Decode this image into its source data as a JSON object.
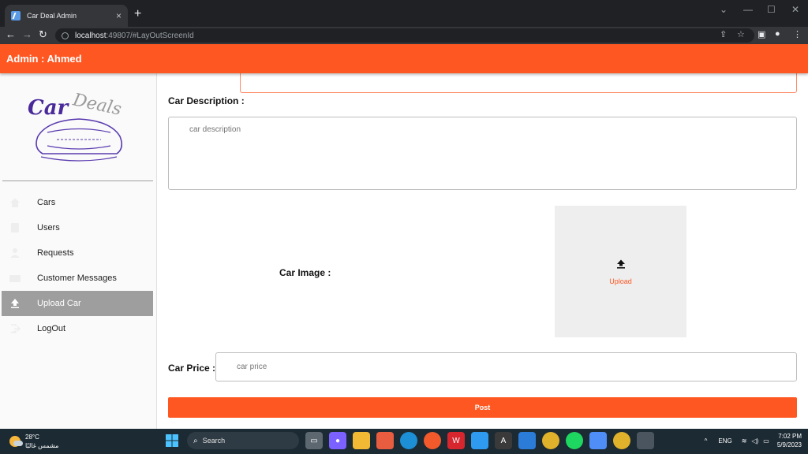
{
  "browser": {
    "tab_title": "Car Deal Admin",
    "tab_close": "×",
    "new_tab": "+",
    "url_host": "localhost",
    "url_rest": ":49807/#LayOutScreenId",
    "window_controls": [
      "⌄",
      "—",
      "☐",
      "✕"
    ]
  },
  "app": {
    "header_title": "Admin : Ahmed",
    "brand_color": "#ff5722",
    "logo_text": "Car Deals"
  },
  "sidebar": {
    "items": [
      {
        "label": "Cars",
        "icon": "home-icon"
      },
      {
        "label": "Users",
        "icon": "document-icon"
      },
      {
        "label": "Requests",
        "icon": "person-icon"
      },
      {
        "label": "Customer Messages",
        "icon": "messages-icon"
      },
      {
        "label": "Upload Car",
        "icon": "upload-icon",
        "active": true
      },
      {
        "label": "LogOut",
        "icon": "logout-icon"
      }
    ]
  },
  "form": {
    "description_label": "Car Description :",
    "description_placeholder": "car description",
    "image_label": "Car Image :",
    "upload_label": "Upload",
    "price_label": "Car Price :",
    "price_placeholder": "car price",
    "post_label": "Post"
  },
  "taskbar": {
    "temperature": "28°C",
    "weather_text": "مشمس غالبًا",
    "search_label": "Search",
    "language": "ENG",
    "time": "7:02 PM",
    "date": "5/9/2023"
  }
}
